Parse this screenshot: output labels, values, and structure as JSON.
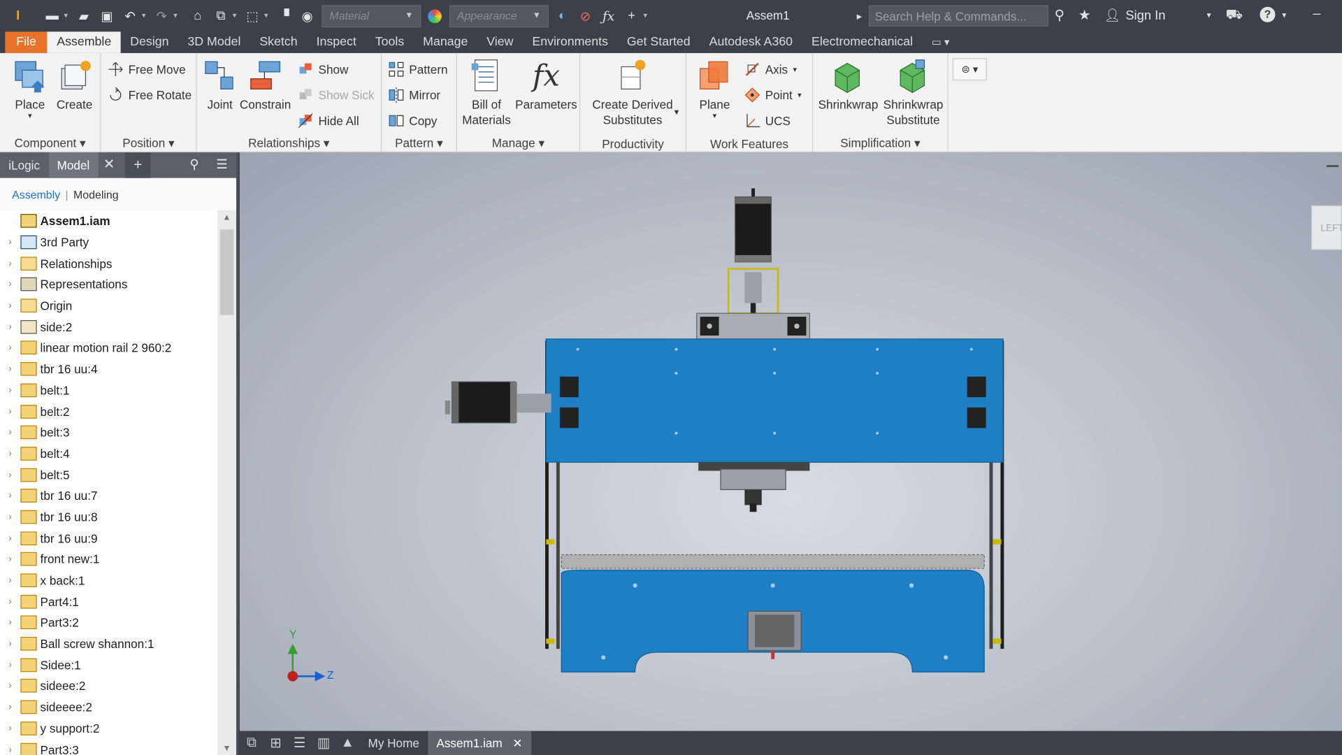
{
  "titlebar": {
    "material_placeholder": "Material",
    "appearance_placeholder": "Appearance",
    "title": "Assem1",
    "search_placeholder": "Search Help & Commands...",
    "signin": "Sign In"
  },
  "menu": {
    "items": [
      "File",
      "Assemble",
      "Design",
      "3D Model",
      "Sketch",
      "Inspect",
      "Tools",
      "Manage",
      "View",
      "Environments",
      "Get Started",
      "Autodesk A360",
      "Electromechanical"
    ]
  },
  "ribbon": {
    "component": {
      "label": "Component",
      "place": "Place",
      "create": "Create"
    },
    "position": {
      "label": "Position",
      "free_move": "Free Move",
      "free_rotate": "Free Rotate"
    },
    "relationships": {
      "label": "Relationships",
      "joint": "Joint",
      "constrain": "Constrain",
      "show": "Show",
      "show_sick": "Show Sick",
      "hide_all": "Hide All"
    },
    "pattern": {
      "label": "Pattern",
      "pattern": "Pattern",
      "mirror": "Mirror",
      "copy": "Copy"
    },
    "manage": {
      "label": "Manage",
      "bom_line1": "Bill of",
      "bom_line2": "Materials",
      "parameters": "Parameters"
    },
    "productivity": {
      "label": "Productivity",
      "cds_line1": "Create Derived",
      "cds_line2": "Substitutes"
    },
    "work_features": {
      "label": "Work Features",
      "plane": "Plane",
      "axis": "Axis",
      "point": "Point",
      "ucs": "UCS"
    },
    "simplification": {
      "label": "Simplification",
      "shrinkwrap": "Shrinkwrap",
      "sws_line1": "Shrinkwrap",
      "sws_line2": "Substitute"
    }
  },
  "browser": {
    "tabs": [
      "iLogic",
      "Model"
    ],
    "sub_assembly": "Assembly",
    "sub_modeling": "Modeling",
    "tree": [
      "Assem1.iam",
      "3rd Party",
      "Relationships",
      "Representations",
      "Origin",
      "side:2",
      "linear motion rail 2 960:2",
      "tbr 16 uu:4",
      "belt:1",
      "belt:2",
      "belt:3",
      "belt:4",
      "belt:5",
      "tbr 16 uu:7",
      "tbr 16 uu:8",
      "tbr 16 uu:9",
      "front new:1",
      "x back:1",
      "Part4:1",
      "Part3:2",
      "Ball screw shannon:1",
      "Sidee:1",
      "sideee:2",
      "sideeee:2",
      "y support:2",
      "Part3:3"
    ]
  },
  "viewport": {
    "viewcube_label": "LEFT",
    "axis_y": "Y",
    "axis_z": "Z",
    "colors": {
      "plate": "#1e7fc4",
      "motor": "#1a1a1a",
      "frame": "#202020",
      "accent": "#c9b800"
    }
  },
  "doctabs": {
    "my_home": "My Home",
    "doc": "Assem1.iam"
  }
}
